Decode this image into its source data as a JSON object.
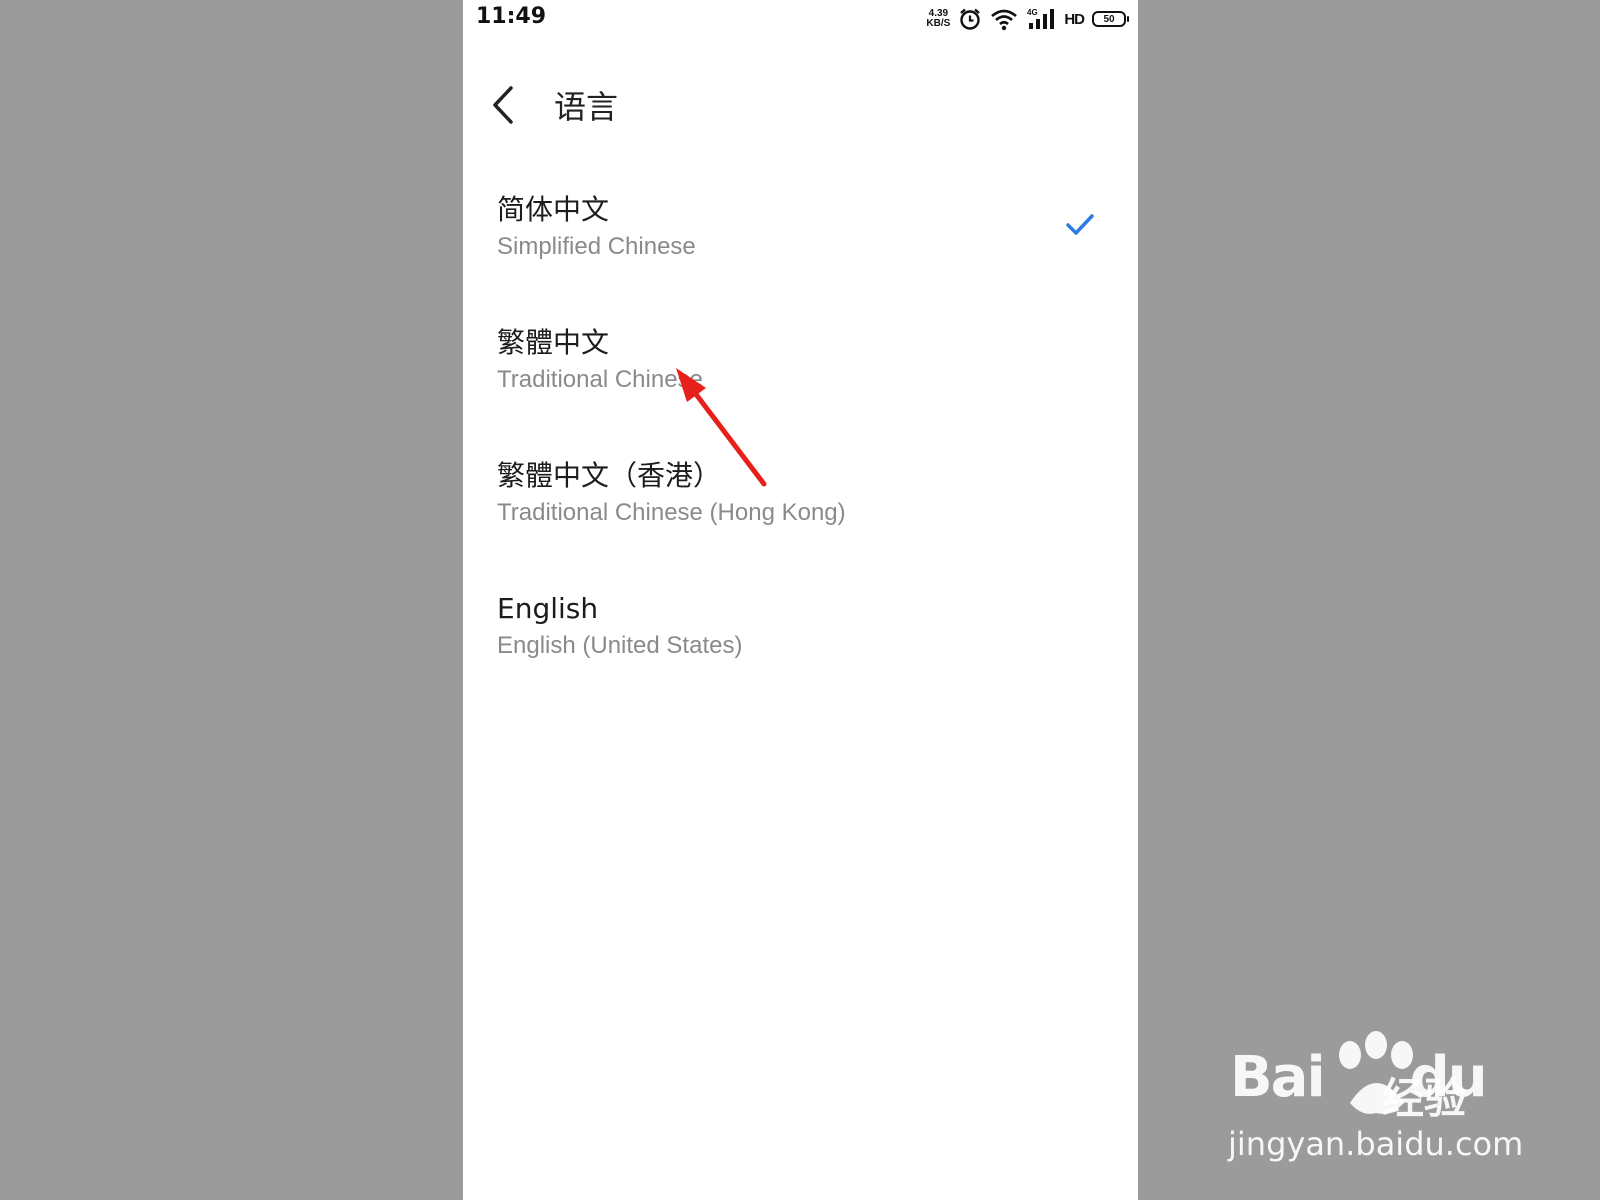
{
  "status_bar": {
    "time": "11:49",
    "net_speed_value": "4.39",
    "net_speed_unit": "KB/S",
    "network_type": "4G",
    "hd_label": "HD",
    "battery_level": "50"
  },
  "header": {
    "title": "语言"
  },
  "languages": [
    {
      "primary": "简体中文",
      "secondary": "Simplified Chinese",
      "selected": true
    },
    {
      "primary": "繁體中文",
      "secondary": "Traditional Chinese",
      "selected": false
    },
    {
      "primary": "繁體中文（香港）",
      "secondary": "Traditional Chinese (Hong Kong)",
      "selected": false
    },
    {
      "primary": "English",
      "secondary": "English (United States)",
      "selected": false
    }
  ],
  "colors": {
    "accent_check": "#2d7be5",
    "annotation_arrow": "#e8201c",
    "background_outer": "#9b9b9b"
  },
  "watermark": {
    "brand": "Bai",
    "brand_suffix": "du",
    "product": "经验",
    "url": "jingyan.baidu.com"
  }
}
